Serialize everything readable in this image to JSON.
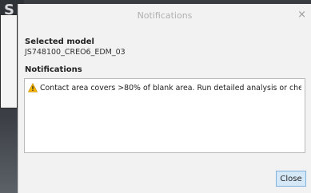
{
  "background": {
    "glyph": "S"
  },
  "dialog": {
    "title": "Notifications",
    "close_symbol": "×",
    "selected_model_label": "Selected model",
    "selected_model_value": "JS748100_CREO6_EDM_03",
    "notifications_label": "Notifications",
    "notifications": [
      {
        "icon": "warning-icon",
        "text": "Contact area covers >80% of blank area. Run detailed analysis or check"
      }
    ],
    "close_button": "Close"
  },
  "colors": {
    "warning": "#f4b400",
    "button_bg": "#d5e8f7",
    "button_border": "#7fb2dc"
  }
}
